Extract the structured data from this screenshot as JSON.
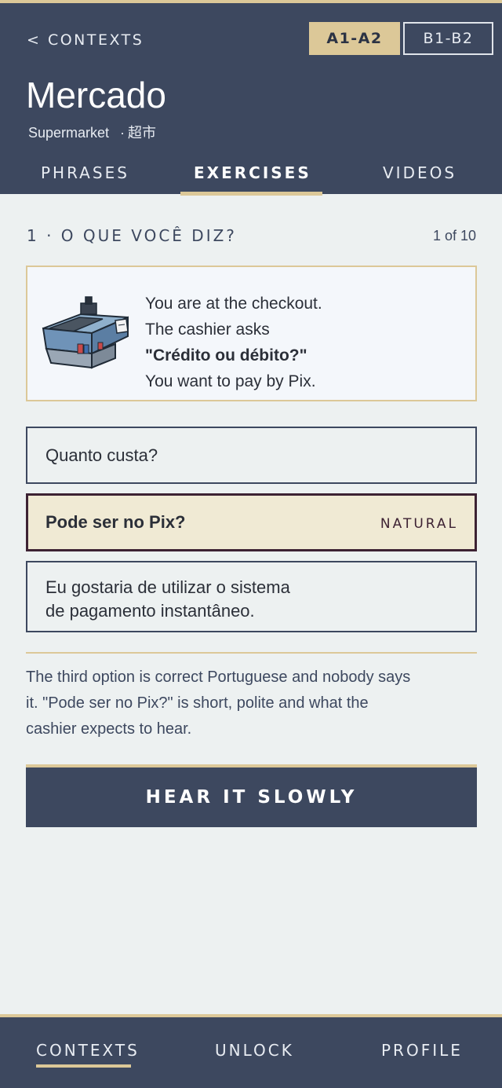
{
  "header": {
    "back_label": "< CONTEXTS",
    "levels": [
      {
        "label": "A1-A2",
        "active": true
      },
      {
        "label": "B1-B2",
        "active": false
      }
    ],
    "title": "Mercado",
    "subtitle_en": "Supermarket",
    "subtitle_sep": "·",
    "subtitle_zh": "超市",
    "tabs": [
      {
        "label": "PHRASES",
        "active": false
      },
      {
        "label": "EXERCISES",
        "active": true
      },
      {
        "label": "VIDEOS",
        "active": false
      }
    ]
  },
  "exercise": {
    "title": "1 · O QUE VOCÊ DIZ?",
    "counter": "1 of 10",
    "scenario_icon": "checkout-counter-icon",
    "scenario_lines": [
      "You are at the checkout.",
      "The cashier asks",
      "\"Crédito ou débito?\"",
      "You want to pay by Pix."
    ],
    "options": [
      {
        "text": "Quanto custa?",
        "selected": false,
        "badge": ""
      },
      {
        "text": "Pode ser no Pix?",
        "selected": true,
        "badge": "NATURAL"
      },
      {
        "text": "Eu gostaria de utilizar o sistema\nde pagamento instantâneo.",
        "selected": false,
        "badge": ""
      }
    ],
    "explanation": "The third option is correct Portuguese and nobody says it. \"Pode ser no Pix?\" is short, polite and what the cashier expects to hear.",
    "hear_button": "HEAR IT SLOWLY"
  },
  "bottom_nav": [
    {
      "label": "CONTEXTS",
      "active": true
    },
    {
      "label": "UNLOCK",
      "active": false
    },
    {
      "label": "PROFILE",
      "active": false
    }
  ],
  "colors": {
    "navy": "#3d485f",
    "gold": "#dcc898",
    "background": "#edf1f1",
    "selected_fill": "#f0ead4",
    "selected_border": "#3d2233"
  }
}
